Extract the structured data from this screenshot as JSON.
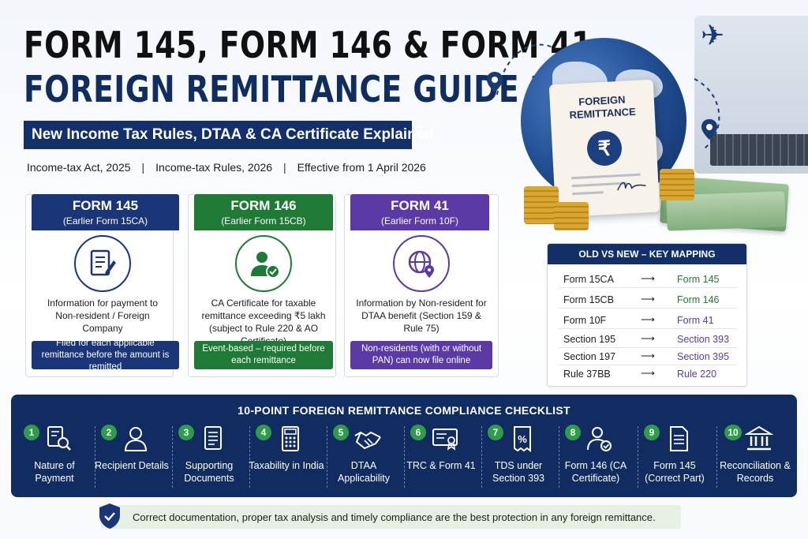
{
  "header": {
    "title_line1": "FORM 145, FORM 146 & FORM 41",
    "title_line2": "FOREIGN REMITTANCE GUIDE 2026",
    "subtitle": "New Income Tax Rules, DTAA & CA Certificate Explained",
    "meta": [
      "Income-tax Act, 2025",
      "Income-tax Rules, 2026",
      "Effective from 1 April 2026"
    ],
    "separator": "|"
  },
  "illustration": {
    "doc_title": "FOREIGN REMITTANCE",
    "rupee_symbol": "₹"
  },
  "forms": [
    {
      "name": "FORM 145",
      "earlier": "(Earlier Form 15CA)",
      "description": "Information for payment to Non-resident / Foreign Company",
      "note": "Filed for each applicable remittance before the amount is remitted",
      "color": "#1a3679",
      "icon": "document-pen-icon"
    },
    {
      "name": "FORM 146",
      "earlier": "(Earlier Form 15CB)",
      "description": "CA Certificate for taxable remittance exceeding ₹5 lakh (subject to Rule 220 & AO Certificate)",
      "note": "Event-based – required before each remittance",
      "color": "#1f7a35",
      "icon": "ca-person-check-icon"
    },
    {
      "name": "FORM 41",
      "earlier": "(Earlier Form 10F)",
      "description": "Information by Non-resident for DTAA benefit (Section 159 & Rule 75)",
      "note": "Non-residents (with or without PAN) can now file online",
      "color": "#5b3aa6",
      "icon": "globe-pin-icon"
    }
  ],
  "mapping": {
    "title": "OLD VS NEW – KEY MAPPING",
    "arrow": "⟶",
    "rows": [
      {
        "old": "Form 15CA",
        "new": "Form 145",
        "color": "#1f7a35"
      },
      {
        "old": "Form 15CB",
        "new": "Form 146",
        "color": "#1f7a35"
      },
      {
        "old": "Form 10F",
        "new": "Form 41",
        "color": "#5b3aa6"
      },
      {
        "old": "Section 195",
        "new": "Section 393",
        "color": "#5b3aa6"
      },
      {
        "old": "Section 197",
        "new": "Section 395",
        "color": "#5b3aa6"
      },
      {
        "old": "Rule 37BB",
        "new": "Rule 220",
        "color": "#5b3aa6"
      }
    ]
  },
  "checklist": {
    "title": "10-POINT FOREIGN REMITTANCE COMPLIANCE CHECKLIST",
    "items": [
      {
        "num": "1",
        "label": "Nature of Payment",
        "icon": "document-search-icon"
      },
      {
        "num": "2",
        "label": "Recipient Details",
        "icon": "person-icon"
      },
      {
        "num": "3",
        "label": "Supporting Documents",
        "icon": "documents-icon"
      },
      {
        "num": "4",
        "label": "Taxability in India",
        "icon": "calculator-icon"
      },
      {
        "num": "5",
        "label": "DTAA Applicability",
        "icon": "handshake-icon"
      },
      {
        "num": "6",
        "label": "TRC & Form 41",
        "icon": "certificate-icon"
      },
      {
        "num": "7",
        "label": "TDS under Section 393",
        "icon": "percent-receipt-icon"
      },
      {
        "num": "8",
        "label": "Form 146 (CA Certificate)",
        "icon": "person-check-icon"
      },
      {
        "num": "9",
        "label": "Form 145 (Correct Part)",
        "icon": "form-icon"
      },
      {
        "num": "10",
        "label": "Reconciliation & Records",
        "icon": "bank-icon"
      }
    ]
  },
  "footer": {
    "text": "Correct documentation, proper tax analysis and timely compliance are the best protection in any foreign remittance.",
    "icon": "shield-check-icon"
  }
}
